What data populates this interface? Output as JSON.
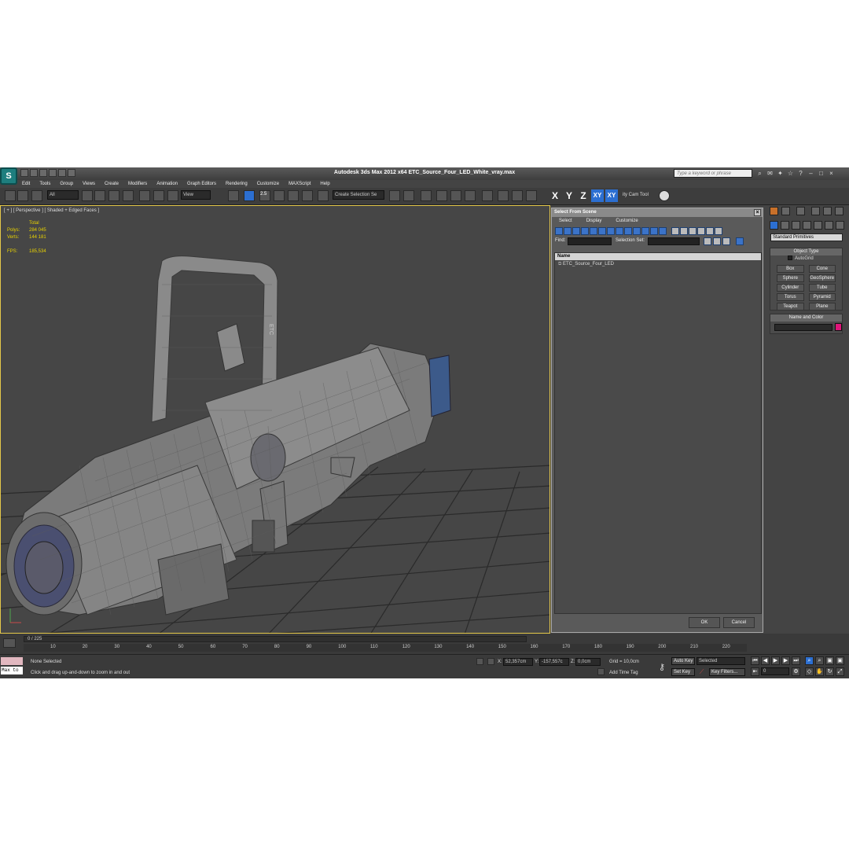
{
  "app": {
    "logo_glyph": "S",
    "window_title": "Autodesk 3ds Max  2012 x64     ETC_Source_Four_LED_White_vray.max",
    "search_placeholder": "Type a keyword or phrase"
  },
  "menu": [
    "Edit",
    "Tools",
    "Group",
    "Views",
    "Create",
    "Modifiers",
    "Animation",
    "Graph Editors",
    "Rendering",
    "Customize",
    "MAXScript",
    "Help"
  ],
  "toolbar": {
    "filter_value": "All",
    "ref_coord_value": "View",
    "angle_snap_label": "2.5",
    "selection_set_value": "Create Selection Se",
    "axis_x": "X",
    "axis_y": "Y",
    "axis_z": "Z",
    "axis_xy": "XY",
    "axis_xy2": "XY",
    "tool_label": "ity Cam Tool"
  },
  "viewport": {
    "label": "[ + ] [ Perspective ] [ Shaded + Edged Faces ]",
    "stats_header": "Total",
    "stats": [
      {
        "label": "Polys:",
        "value": "284 045"
      },
      {
        "label": "Verts:",
        "value": "144 181"
      }
    ],
    "fps_label": "FPS:",
    "fps_value": "185,534",
    "fixture_text": "ETC"
  },
  "select_dialog": {
    "title": "Select From Scene",
    "close_glyph": "×",
    "menu": [
      "Select",
      "Display",
      "Customize"
    ],
    "find_label": "Find:",
    "selection_set_label": "Selection Set:",
    "column_header": "Name",
    "items": [
      "ETC_Source_Four_LED"
    ],
    "ok_label": "OK",
    "cancel_label": "Cancel"
  },
  "command_panel": {
    "category": "Standard Primitives",
    "object_type_header": "Object Type",
    "autogrid_label": "AutoGrid",
    "objects": [
      "Box",
      "Cone",
      "Sphere",
      "GeoSphere",
      "Cylinder",
      "Tube",
      "Torus",
      "Pyramid",
      "Teapot",
      "Plane"
    ],
    "name_color_header": "Name and Color",
    "color_swatch": "#e0157a"
  },
  "timeline": {
    "frame_indicator": "0 / 225",
    "ticks": [
      "10",
      "20",
      "30",
      "40",
      "50",
      "60",
      "70",
      "80",
      "90",
      "100",
      "110",
      "120",
      "130",
      "140",
      "150",
      "160",
      "170",
      "180",
      "190",
      "200",
      "210",
      "220"
    ]
  },
  "status": {
    "maxscript_label": "Max to",
    "selection": "None Selected",
    "prompt": "Click and drag up-and-down to zoom in and out",
    "x_label": "X:",
    "x_value": "52,357cm",
    "y_label": "Y:",
    "y_value": "-157,557c",
    "z_label": "Z:",
    "z_value": "0,0cm",
    "grid": "Grid = 10,0cm",
    "add_time_tag": "Add Time Tag",
    "auto_key": "Auto Key",
    "set_key": "Set Key",
    "key_mode_value": "Selected",
    "key_filters": "Key Filters...",
    "current_frame": "0"
  }
}
